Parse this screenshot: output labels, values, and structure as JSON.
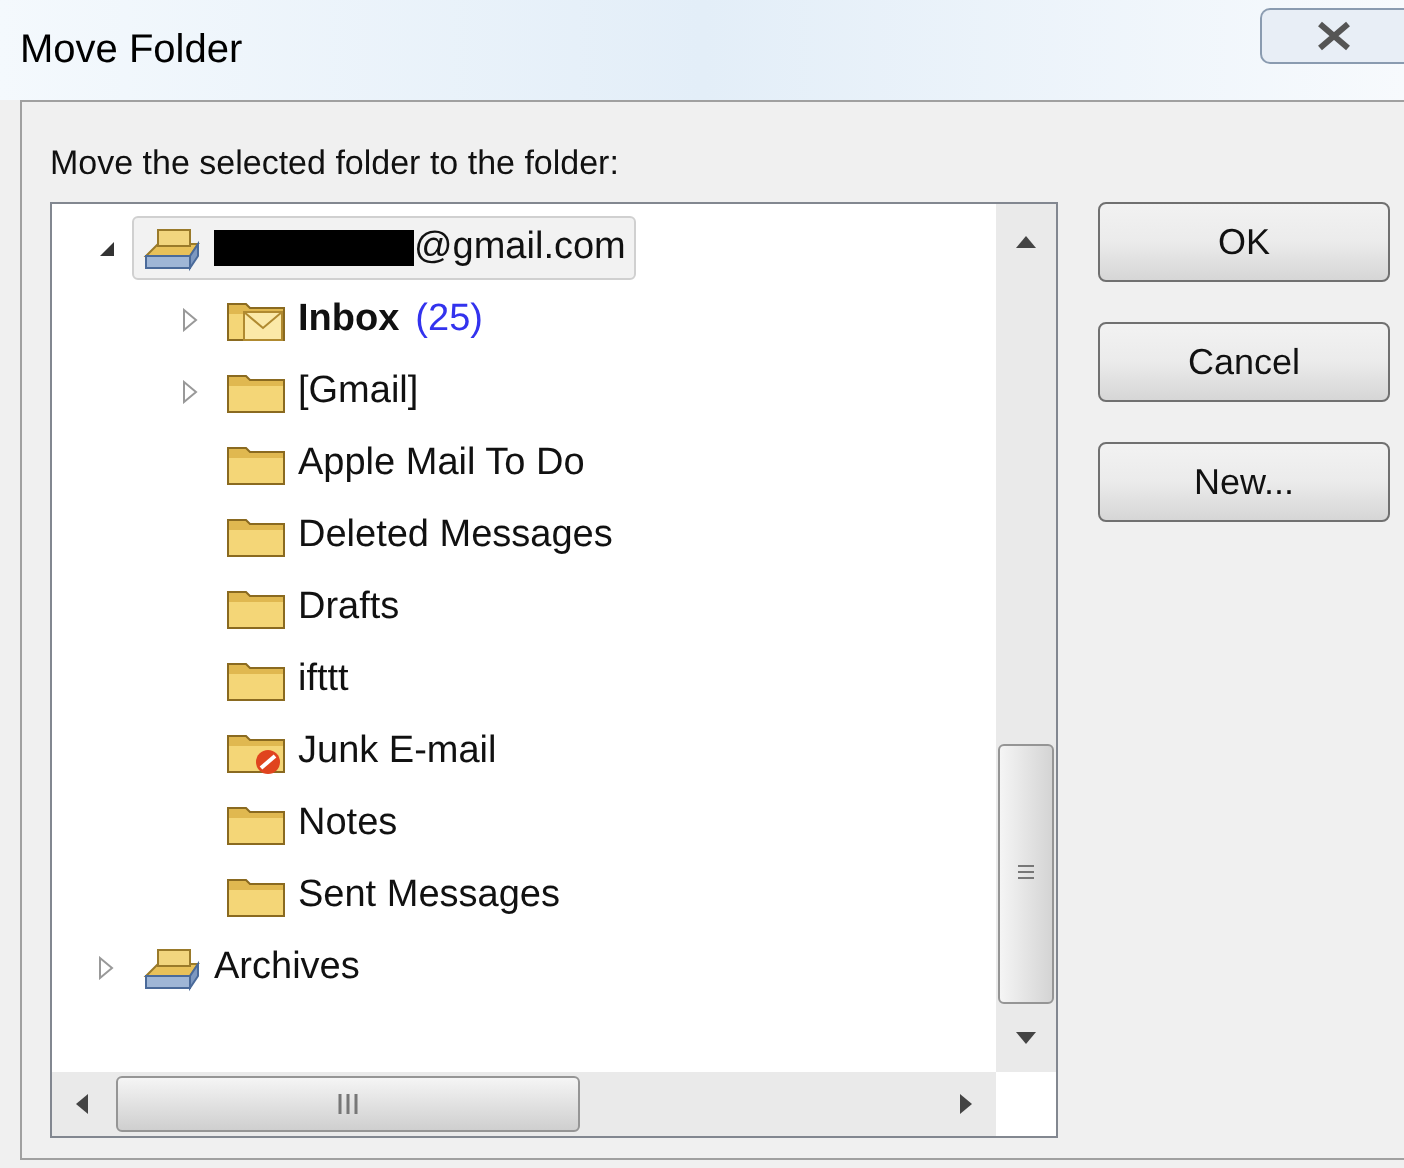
{
  "window": {
    "title": "Move Folder"
  },
  "prompt": "Move the selected folder to the folder:",
  "tree": [
    {
      "label": "@gmail.com",
      "redacted": true,
      "kind": "store",
      "expanded": true,
      "selected": true,
      "children": [
        {
          "label": "Inbox",
          "count": "(25)",
          "bold": true,
          "kind": "mail",
          "expanded": false,
          "selected": false
        },
        {
          "label": "[Gmail]",
          "kind": "folder",
          "expanded": false,
          "selected": false
        },
        {
          "label": "Apple Mail To Do",
          "kind": "folder",
          "selected": false
        },
        {
          "label": "Deleted Messages",
          "kind": "folder",
          "selected": false
        },
        {
          "label": "Drafts",
          "kind": "folder",
          "selected": false
        },
        {
          "label": "ifttt",
          "kind": "folder",
          "selected": false
        },
        {
          "label": "Junk E-mail",
          "kind": "junk",
          "selected": false
        },
        {
          "label": "Notes",
          "kind": "folder",
          "selected": false
        },
        {
          "label": "Sent Messages",
          "kind": "folder",
          "selected": false
        }
      ]
    },
    {
      "label": "Archives",
      "kind": "store",
      "expanded": false,
      "selected": false
    }
  ],
  "buttons": [
    "OK",
    "Cancel",
    "New..."
  ]
}
